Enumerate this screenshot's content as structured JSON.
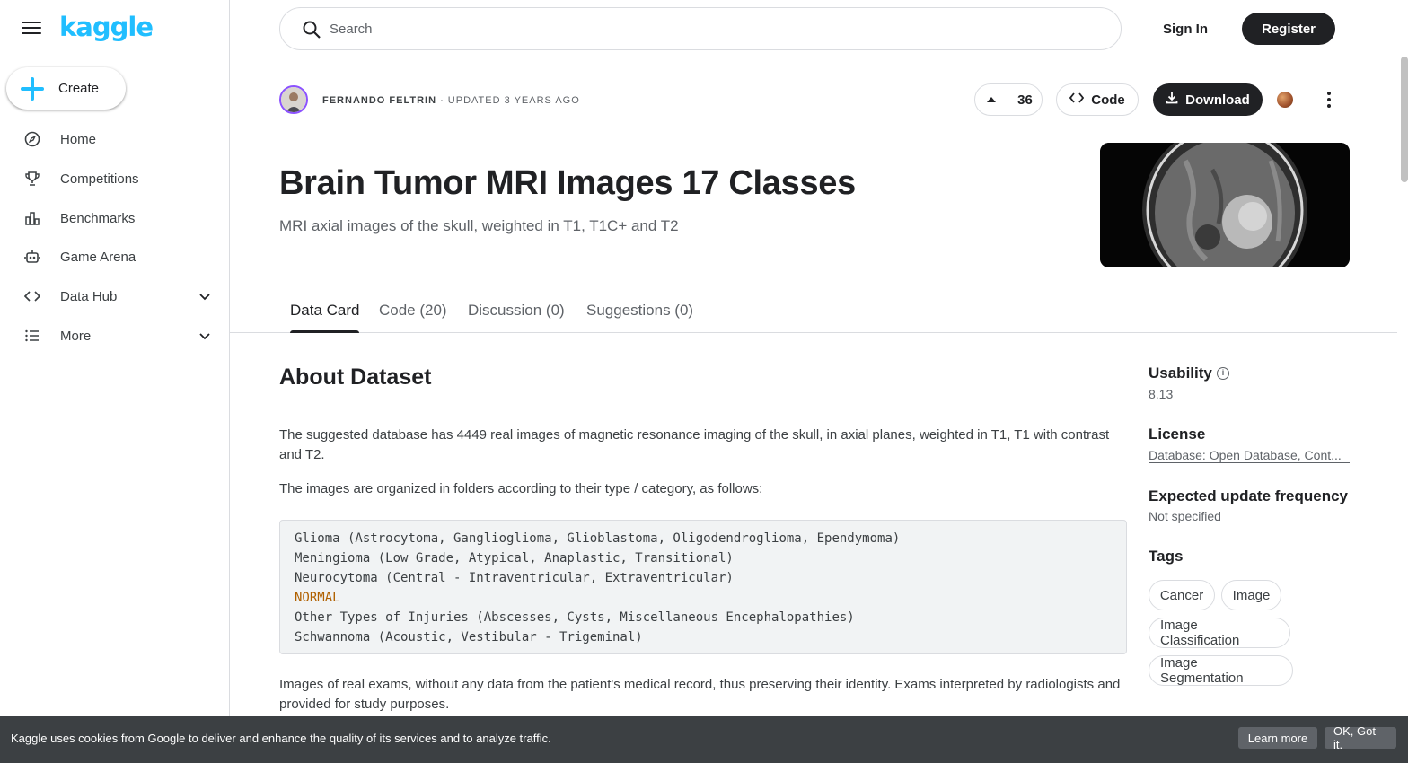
{
  "app": {
    "logo": "kaggle"
  },
  "sidebar": {
    "create_label": "Create",
    "items": [
      {
        "label": "Home",
        "icon": "compass-icon"
      },
      {
        "label": "Competitions",
        "icon": "trophy-icon"
      },
      {
        "label": "Benchmarks",
        "icon": "bar-chart-icon"
      },
      {
        "label": "Game Arena",
        "icon": "robot-icon"
      },
      {
        "label": "Data Hub",
        "icon": "code-icon"
      },
      {
        "label": "More",
        "icon": "list-icon"
      }
    ]
  },
  "topbar": {
    "search_placeholder": "Search",
    "signin_label": "Sign In",
    "register_label": "Register"
  },
  "dataset": {
    "author": "FERNANDO FELTRIN",
    "updated": "· UPDATED 3 YEARS AGO",
    "upvotes": "36",
    "code_label": "Code",
    "download_label": "Download",
    "title": "Brain Tumor MRI Images 17 Classes",
    "subtitle": "MRI axial images of the skull, weighted in T1, T1C+ and T2"
  },
  "tabs": [
    {
      "label": "Data Card",
      "active": true
    },
    {
      "label": "Code (20)",
      "active": false
    },
    {
      "label": "Discussion (0)",
      "active": false
    },
    {
      "label": "Suggestions (0)",
      "active": false
    }
  ],
  "about": {
    "heading": "About Dataset",
    "para1": "The suggested database has 4449 real images of magnetic resonance imaging of the skull, in axial planes, weighted in T1, T1 with contrast and T2.",
    "para2": "The images are organized in folders according to their type / category, as follows:",
    "code_lines": [
      "Glioma (Astrocytoma, Ganglioglioma, Glioblastoma, Oligodendroglioma, Ependymoma)",
      "Meningioma (Low Grade, Atypical, Anaplastic, Transitional)",
      "Neurocytoma (Central - Intraventricular, Extraventricular)",
      "NORMAL",
      "Other Types of Injuries (Abscesses, Cysts, Miscellaneous Encephalopathies)",
      "Schwannoma (Acoustic, Vestibular - Trigeminal)"
    ],
    "para3": "Images of real exams, without any data from the patient's medical record, thus preserving their identity. Exams interpreted by radiologists and provided for study purposes."
  },
  "meta": {
    "usability_label": "Usability",
    "usability_value": "8.13",
    "license_label": "License",
    "license_value": "Database: Open Database, Cont...",
    "frequency_label": "Expected update frequency",
    "frequency_value": "Not specified",
    "tags_label": "Tags",
    "tags": [
      "Cancer",
      "Image",
      "Image Classification",
      "Image Segmentation"
    ]
  },
  "cookie": {
    "message": "Kaggle uses cookies from Google to deliver and enhance the quality of its services and to analyze traffic.",
    "learn_more": "Learn more",
    "ok": "OK, Got it."
  },
  "colors": {
    "brand": "#20beff",
    "dark": "#202124",
    "avatar_ring": "#8c52ff"
  }
}
